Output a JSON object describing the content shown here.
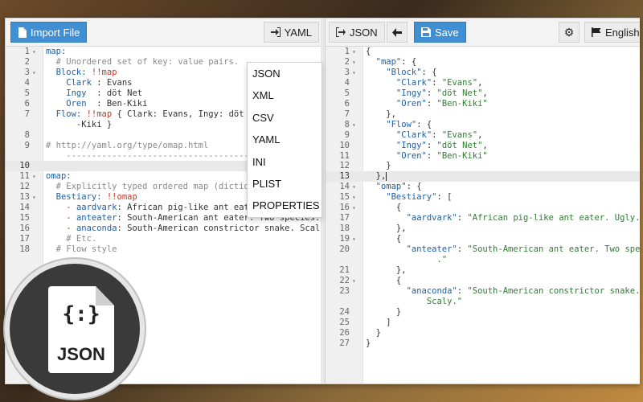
{
  "left_toolbar": {
    "import_label": "Import File",
    "format_label": "YAML"
  },
  "right_toolbar": {
    "json_label": "JSON",
    "save_label": "Save",
    "language_label": "English"
  },
  "dropdown": {
    "items": [
      "JSON",
      "XML",
      "CSV",
      "YAML",
      "INI",
      "PLIST",
      "PROPERTIES"
    ]
  },
  "left_lines": [
    {
      "n": "1",
      "f": "▾",
      "segs": [
        [
          "key",
          "map:"
        ]
      ]
    },
    {
      "n": "2",
      "f": "",
      "segs": [
        [
          "cmt",
          "  # Unordered set of key: value pairs."
        ]
      ]
    },
    {
      "n": "3",
      "f": "▾",
      "segs": [
        [
          "key",
          "  Block: "
        ],
        [
          "tag",
          "!!map"
        ]
      ]
    },
    {
      "n": "4",
      "f": "",
      "segs": [
        [
          "key",
          "    Clark"
        ],
        [
          "plain",
          " : Evans"
        ]
      ]
    },
    {
      "n": "5",
      "f": "",
      "segs": [
        [
          "key",
          "    Ingy"
        ],
        [
          "plain",
          "  : döt Net"
        ]
      ]
    },
    {
      "n": "6",
      "f": "",
      "segs": [
        [
          "key",
          "    Oren"
        ],
        [
          "plain",
          "  : Ben-Kiki"
        ]
      ]
    },
    {
      "n": "7",
      "f": "",
      "segs": [
        [
          "key",
          "  Flow: "
        ],
        [
          "tag",
          "!!map"
        ],
        [
          "plain",
          " { Clark: Evans, Ingy: döt Net,"
        ]
      ]
    },
    {
      "n": "",
      "f": "",
      "segs": [
        [
          "plain",
          "      -Kiki }"
        ]
      ]
    },
    {
      "n": "8",
      "f": "",
      "segs": [
        [
          "plain",
          ""
        ]
      ]
    },
    {
      "n": "9",
      "f": "",
      "segs": [
        [
          "cmt",
          "# http://yaml.org/type/omap.html"
        ]
      ]
    },
    {
      "n": "",
      "f": "",
      "segs": [
        [
          "cmt",
          "    -----------------------------------------"
        ]
      ]
    },
    {
      "n": "10",
      "f": "",
      "segs": [
        [
          "plain",
          ""
        ]
      ],
      "active": true
    },
    {
      "n": "11",
      "f": "▾",
      "segs": [
        [
          "key",
          "omap:"
        ]
      ]
    },
    {
      "n": "12",
      "f": "",
      "segs": [
        [
          "cmt",
          "  # Explicitly typed ordered map (dictiona"
        ]
      ]
    },
    {
      "n": "13",
      "f": "▾",
      "segs": [
        [
          "key",
          "  Bestiary: "
        ],
        [
          "tag",
          "!!omap"
        ]
      ]
    },
    {
      "n": "14",
      "f": "",
      "segs": [
        [
          "tag",
          "    - "
        ],
        [
          "key",
          "aardvark"
        ],
        [
          "plain",
          ": African pig-like ant eater. Ugly."
        ]
      ]
    },
    {
      "n": "15",
      "f": "",
      "segs": [
        [
          "tag",
          "    - "
        ],
        [
          "key",
          "anteater"
        ],
        [
          "plain",
          ": South-American ant eater. Two species."
        ]
      ]
    },
    {
      "n": "16",
      "f": "",
      "segs": [
        [
          "tag",
          "    - "
        ],
        [
          "key",
          "anaconda"
        ],
        [
          "plain",
          ": South-American constrictor snake. Scaly."
        ]
      ]
    },
    {
      "n": "17",
      "f": "",
      "segs": [
        [
          "cmt",
          "    # Etc."
        ]
      ]
    },
    {
      "n": "18",
      "f": "",
      "segs": [
        [
          "cmt",
          "  # Flow style"
        ]
      ]
    }
  ],
  "right_lines": [
    {
      "n": "1",
      "f": "▾",
      "segs": [
        [
          "plain",
          "{"
        ]
      ]
    },
    {
      "n": "2",
      "f": "▾",
      "segs": [
        [
          "key",
          "  \"map\""
        ],
        [
          "plain",
          ": {"
        ]
      ]
    },
    {
      "n": "3",
      "f": "▾",
      "segs": [
        [
          "key",
          "    \"Block\""
        ],
        [
          "plain",
          ": {"
        ]
      ]
    },
    {
      "n": "4",
      "f": "",
      "segs": [
        [
          "key",
          "      \"Clark\""
        ],
        [
          "plain",
          ": "
        ],
        [
          "str",
          "\"Evans\""
        ],
        [
          "plain",
          ","
        ]
      ]
    },
    {
      "n": "5",
      "f": "",
      "segs": [
        [
          "key",
          "      \"Ingy\""
        ],
        [
          "plain",
          ": "
        ],
        [
          "str",
          "\"döt Net\""
        ],
        [
          "plain",
          ","
        ]
      ]
    },
    {
      "n": "6",
      "f": "",
      "segs": [
        [
          "key",
          "      \"Oren\""
        ],
        [
          "plain",
          ": "
        ],
        [
          "str",
          "\"Ben-Kiki\""
        ]
      ]
    },
    {
      "n": "7",
      "f": "",
      "segs": [
        [
          "plain",
          "    },"
        ]
      ]
    },
    {
      "n": "8",
      "f": "▾",
      "segs": [
        [
          "key",
          "    \"Flow\""
        ],
        [
          "plain",
          ": {"
        ]
      ]
    },
    {
      "n": "9",
      "f": "",
      "segs": [
        [
          "key",
          "      \"Clark\""
        ],
        [
          "plain",
          ": "
        ],
        [
          "str",
          "\"Evans\""
        ],
        [
          "plain",
          ","
        ]
      ]
    },
    {
      "n": "10",
      "f": "",
      "segs": [
        [
          "key",
          "      \"Ingy\""
        ],
        [
          "plain",
          ": "
        ],
        [
          "str",
          "\"döt Net\""
        ],
        [
          "plain",
          ","
        ]
      ]
    },
    {
      "n": "11",
      "f": "",
      "segs": [
        [
          "key",
          "      \"Oren\""
        ],
        [
          "plain",
          ": "
        ],
        [
          "str",
          "\"Ben-Kiki\""
        ]
      ]
    },
    {
      "n": "12",
      "f": "",
      "segs": [
        [
          "plain",
          "    }"
        ]
      ]
    },
    {
      "n": "13",
      "f": "",
      "segs": [
        [
          "plain",
          "  },"
        ]
      ],
      "active": true,
      "cursor": true
    },
    {
      "n": "14",
      "f": "▾",
      "segs": [
        [
          "key",
          "  \"omap\""
        ],
        [
          "plain",
          ": {"
        ]
      ]
    },
    {
      "n": "15",
      "f": "▾",
      "segs": [
        [
          "key",
          "    \"Bestiary\""
        ],
        [
          "plain",
          ": ["
        ]
      ]
    },
    {
      "n": "16",
      "f": "▾",
      "segs": [
        [
          "plain",
          "      {"
        ]
      ]
    },
    {
      "n": "17",
      "f": "",
      "segs": [
        [
          "key",
          "        \"aardvark\""
        ],
        [
          "plain",
          ": "
        ],
        [
          "str",
          "\"African pig-like ant eater. Ugly.\""
        ]
      ]
    },
    {
      "n": "18",
      "f": "",
      "segs": [
        [
          "plain",
          "      },"
        ]
      ]
    },
    {
      "n": "19",
      "f": "▾",
      "segs": [
        [
          "plain",
          "      {"
        ]
      ]
    },
    {
      "n": "20",
      "f": "",
      "segs": [
        [
          "key",
          "        \"anteater\""
        ],
        [
          "plain",
          ": "
        ],
        [
          "str",
          "\"South-American ant eater. Two species"
        ]
      ]
    },
    {
      "n": "",
      "f": "",
      "segs": [
        [
          "str",
          "              .\""
        ]
      ]
    },
    {
      "n": "21",
      "f": "",
      "segs": [
        [
          "plain",
          "      },"
        ]
      ]
    },
    {
      "n": "22",
      "f": "▾",
      "segs": [
        [
          "plain",
          "      {"
        ]
      ]
    },
    {
      "n": "23",
      "f": "",
      "segs": [
        [
          "key",
          "        \"anaconda\""
        ],
        [
          "plain",
          ": "
        ],
        [
          "str",
          "\"South-American constrictor snake."
        ]
      ]
    },
    {
      "n": "",
      "f": "",
      "segs": [
        [
          "str",
          "            Scaly.\""
        ]
      ]
    },
    {
      "n": "24",
      "f": "",
      "segs": [
        [
          "plain",
          "      }"
        ]
      ]
    },
    {
      "n": "25",
      "f": "",
      "segs": [
        [
          "plain",
          "    ]"
        ]
      ]
    },
    {
      "n": "26",
      "f": "",
      "segs": [
        [
          "plain",
          "  }"
        ]
      ]
    },
    {
      "n": "27",
      "f": "",
      "segs": [
        [
          "plain",
          "}"
        ]
      ]
    }
  ],
  "badge": {
    "braces": "{:}",
    "label": "JSON"
  },
  "colors": {
    "accent": "#3f8fd2",
    "key": "#1f5fa0",
    "string": "#2e7d32",
    "comment": "#8a8a8a",
    "tag": "#c0392b"
  }
}
